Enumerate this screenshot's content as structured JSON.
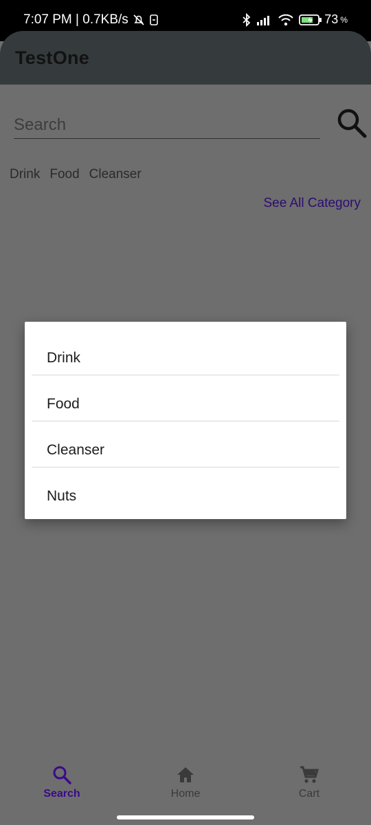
{
  "status_bar": {
    "time_speed": "7:07 PM | 0.7KB/s",
    "battery": "73"
  },
  "app_bar": {
    "title": "TestOne"
  },
  "search": {
    "placeholder": "Search"
  },
  "categories": [
    "Drink",
    "Food",
    "Cleanser"
  ],
  "see_all_label": "See All Category",
  "dialog": {
    "items": [
      "Drink",
      "Food",
      "Cleanser",
      "Nuts"
    ]
  },
  "bottom_nav": [
    {
      "label": "Search",
      "icon": "search-icon",
      "active": true
    },
    {
      "label": "Home",
      "icon": "home-icon",
      "active": false
    },
    {
      "label": "Cart",
      "icon": "cart-icon",
      "active": false
    }
  ],
  "colors": {
    "accent": "#3a0a8a",
    "link": "#2d0b73",
    "app_bar": "#353b3d",
    "scrim_background": "#6e6e6e"
  }
}
